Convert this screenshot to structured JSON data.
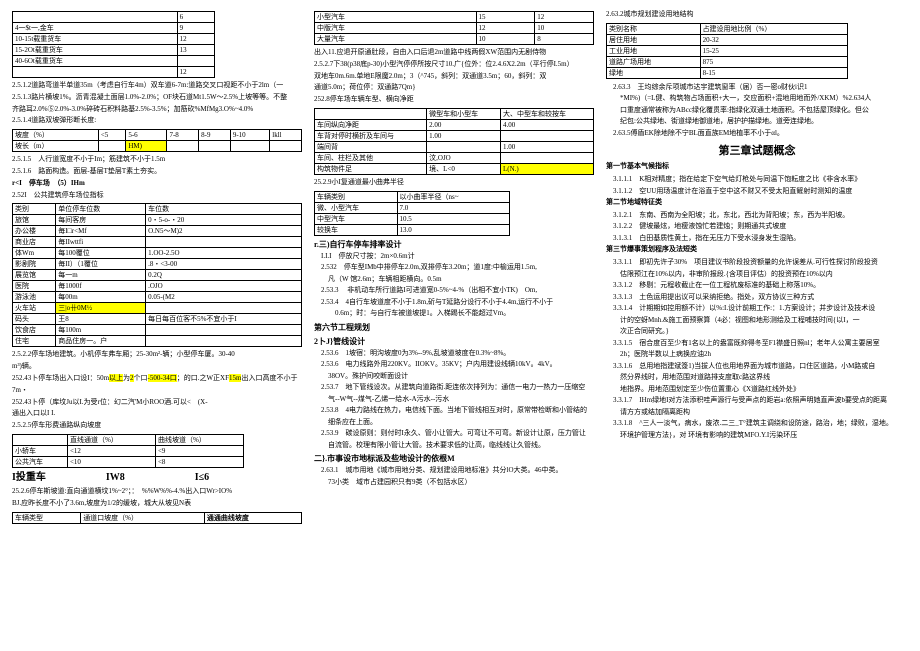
{
  "col1": {
    "t1": {
      "rows": [
        [
          "",
          "6"
        ],
        [
          "4一$t一,金车",
          "9"
        ],
        [
          "10-15t载重货车",
          "12"
        ],
        [
          "15-2Ot载重货车",
          "13"
        ],
        [
          "40-6Ot载重货车",
          ""
        ],
        [
          "",
          "12"
        ]
      ]
    },
    "p1": "2.5.1.2道路弯道半单道35m（考虑自行车4m）双车道6-7m:道路交叉口视距不小于2lm（一",
    "p2": "2.5.1.3路片横坡1%。沥青混凝土面层1.0%-2.0%；OF块石道Mt1.5W～2.5%上坡等等。不整",
    "p2b": "齐路耳2.0%⑤2.0%-3.0%碎砖石积料路基2.5%-3.5%；加筋砍%MfMg3.O%~4.0%",
    "p3": "2.5.1.4道路双坡弹形断长度:",
    "t2": {
      "head": [
        "坡度（%）",
        "<5",
        "5-6",
        "7-8",
        "8-9",
        "9-10",
        "lkll"
      ],
      "row": [
        "坡长（m）",
        "",
        "HM)",
        "",
        "",
        "",
        ""
      ]
    },
    "p4a": "2.5.1.5　人行道宽度不小于Im；筋建筑不小于1.5m",
    "p4_hl": "1.5m",
    "p5": "2.5.1.6　路面构造。面层-基层T垫层T素土夯实。",
    "p6": "r<I　停车场　（5）IHm",
    "p7": "2.52I　公共建筑停车场位指标",
    "t3": {
      "head": [
        "类别",
        "单位停车位数",
        "车位数"
      ],
      "rows": [
        [
          "旅馆",
          "每间客房",
          "0・5-o-・20"
        ],
        [
          "办公楼",
          "毎I□r<Mf",
          "O.N5～M)2"
        ],
        [
          "商业店",
          "毎IIwttfi",
          ""
        ],
        [
          "体Wm",
          "每100覆位",
          "1.OO-2.5O"
        ],
        [
          "影剧院",
          "毎II）（1覆位",
          ".8・<3-00"
        ],
        [
          "展览馆",
          "每一m",
          "0.2Q"
        ],
        [
          "医院",
          "毎1000f",
          ".OJO"
        ],
        [
          "游泳池",
          "每00m",
          "0.05-(M2"
        ],
        [
          "火车站",
          "三|o卄0M½",
          ""
        ],
        [
          "码头",
          "王8",
          "每日每百位客不5%不宜小于I"
        ],
        [
          "饮食店",
          "每100m",
          ""
        ],
        [
          "住宅",
          "商品住房一。户",
          ""
        ]
      ]
    },
    "p8": "2.5.2.2停车场地建筑。小机停车弗车厢；25-30m²-辆；小型停车厦。30-40",
    "p8b": "m³)辆。",
    "p9": "252.43卜停（库坟Ju以I.为受r位：幻二汽'M小ROO酒.可以<　(X-",
    "p9b": "通出入口以I I.",
    "p10": "2.5.2.5停车形费通路纵向坡度",
    "t4": {
      "head": [
        "",
        "直线通道（%）",
        "曲线坡道（%）"
      ],
      "rows": [
        [
          "小轿车",
          "<12",
          "<9"
        ],
        [
          "公共汽车",
          "<10",
          "<8"
        ]
      ]
    },
    "p11": "I投重车　　　　　　IW8　　　　　　　I≤6",
    "p12": "25.2.6停车斯坡道:直向通道横坟1%~2°；：　%%W%%-4.%出入口Wr>IO%",
    "p12b": "BJ.应昨长度不小了3.6m,坡度为1/2的缓坡，城大从坡见N表",
    "t5": {
      "head": [
        "车辆类型",
        "通道口坡度（%）",
        "通通曲线坡度"
      ]
    }
  },
  "col2": {
    "t1": {
      "rows": [
        [
          "小型汽车",
          "15",
          "12"
        ],
        [
          "中版汽车",
          "12",
          "10"
        ],
        [
          "大量汽车",
          "10",
          "8"
        ]
      ]
    },
    "p1": "出入11.应退开原通肚段，自由入口后退2m道路中线两假XW范围内无剧侍物",
    "p2": "2.5.2.7下38(p38底p-30)小型汽停停所按尺寸10.广{位外：位2.4.6X2.2m（平行停I.5m）",
    "p2b": "双地车0m.6m.单地E限魔2.0m；3（^745，斜列：双通道3.5m；60，斜列：双",
    "p2c": "通道5.0m；荷位停：双通路7Qm}",
    "p3": "252.8停车场车辆车型、横向净距",
    "t2": {
      "head": [
        "",
        "微型车和小型车",
        "大、中型车和较按车"
      ],
      "rows": [
        [
          "车间纵向净距",
          "2.00",
          "4.00"
        ],
        [
          "车背对停时横折及车间与",
          "1.00",
          ""
        ],
        [
          "端间背",
          "",
          "1.00"
        ],
        [
          "车间、柱栏及其他",
          "汶,OJO",
          ""
        ],
        [
          "构筑物件足",
          "境、L<0",
          "L(N.)"
        ]
      ]
    },
    "p4": "25.2.9小I复通道最小曲弗半径",
    "t3": {
      "head": [
        "车辆类别",
        "以小曲率半径（ns~"
      ],
      "rows": [
        [
          "微、小型汽车",
          "7.0"
        ],
        [
          "中型汽车",
          "10.5"
        ],
        [
          "较换车",
          "13.0"
        ]
      ]
    },
    "sec1": "r.三)自行车停车排率设计",
    "i1": "I.I.I　停放尺寸按：2m×0.6m计",
    "i2": "2.532　停车型IMb中排停车2.0m,双排停车3.20m；道1度:中榆运用1.5m,",
    "i2b": "凡（W 馆2.6m；车辆相距横向。0.5m",
    "i3": "2.53.3　 非机动车所行道路I可进道宽0-5%~4-%（出相不宜小TK)　Om,",
    "i4": "2.53.4　4自行车坡道度不小于1.8m,斫与T延路分设行不小于4.4m,运行不小于",
    "i4b": "　0.6m；时：与自行车被道坡提1。入梯踢长不能超过Vm。",
    "sec2": "第六节工程规划",
    "sec3": "2卜J}管线设计",
    "i5": "2.53.6　1坡宿：明沟坡度0为3%--9%,乱坡道坡度在0.3%~8%。",
    "i6": "2.53.6　电力线路外用220KV。IIOKV。35KV；户内用建设线辆10kV。4kV。",
    "i6b": "38OV。殊护间咬断面设计",
    "i7": "2.53.7　地下管线设次。从建筑向道路街.距连依次排列为：通信一电力一热力一压缩空",
    "i7b": "气--W气--煤气-乙烯一给水-A污水--污水",
    "i8": "2.53.8　4电力路线在热力，电信线下面。当地下管线相互对时，原常带检断和小管结的",
    "i8b": "细条应在上面。",
    "i9": "2.53.9　碳设原则：则付时I永久、管小让管大。可弯让不可弯。新设计让原，压力管让",
    "i9b": "自流管。校理有限小管让大管。技术要求低的让高，临线线让久管线。",
    "sec4": "二}.市事设市地标派及些地设计的依根M",
    "i10": "2.63.1　城市用地《城市用地分类、规划建设用地标准》共分lO大类。46中类。",
    "i10b": "73小类　域市占建园积只有9类（不包括水区）"
  },
  "col3": {
    "sec0": "2.63.2城市规划建设用地结构",
    "t1": {
      "head": [
        "类别名称",
        "占建设用地比例（%）"
      ],
      "rows": [
        [
          "居住用地",
          "20-32"
        ],
        [
          "工业用地",
          "15-25"
        ],
        [
          "道路广场用地",
          "875"
        ],
        [
          "绿地",
          "8-15"
        ]
      ]
    },
    "i1": "2.63.3　王均综余斥项城市达宇建筑窗率（届）否一密o财伙i识1",
    "i1b": "*MI%)（=L健、构筑物占场面积+大一，交应面积+混地用地而外/XKM）%2.634人",
    "i1c": "口重度通常被称为ABcc绿化覆贯率:指绿化双通土地面积。不包括屋顶绿化。但公",
    "i1d": "纪包:公共绿地、街道绿地御道地，居护护描绿地。道旁连绿地。",
    "i2": "2.63.5傅盾EK除地除不宁BL面直族EM地植率不小于αl。",
    "title": "第三章试题概念",
    "sec1": "第一节基本气候指标",
    "i3": "3.1.1.1　K相对精度；指在给定下空气给灯枪处与同温下饱耘度之比《非含水率》",
    "i4": "3.1.1.2　空UU用玚温度计在浴直于空中这不财又不受太阳直鏟射时测知的温度",
    "sec2": "第二节地域特征类",
    "i5": "3.1.2.1　东南、西南为全阳坡；北，东北，西北为背阳坡；东，西为半阳坡。",
    "i6": "3.1.2.2　健坡最炫，地瘦液蚀忙若建烛；则期通共式坡度",
    "i7": "3.1.3.1　白田基质性黄土，指在无压力下受水浸身发生湿陷。",
    "sec3": "第三节爆事策划程序及法短类",
    "i8": "3.3.1.1　即初先许子30%　项目建议书阶段投资额量的允许误差从.可行性探讨阶段投资",
    "i8b": "估限预江在10%以内，非审阶报段.{含项目评估）的投资预在10%以内",
    "i9": "3.3.1.2　移剔：元程收截止在一位工程杭废标准的基础上称落10%。",
    "i10": "3.3.1.3　土色运用提出议可以采纳拒绝。指处，双方协议三种方式",
    "i11": "3.3.1.4　计期期如控用额不计）以%:I.设计前期工作:：1.方案设计；并步设计及技术设",
    "i11b": "计的空蚜Mnh.&施工面预察算（4必：视图和地形测绘及工程哺技时间{以I，一",
    "i11c": "次正合同研究。}",
    "i12": "3.3.1.5　宿合度百至少有1名以上的盎富既抑得冬至F1襟盛日照nl；老年人公寓主要居室",
    "i12b": "2h；医院半数以上病换应油2h",
    "i13": "3.3.1.6　总用地指建斌簽1)当拔人位也用地界面为城市道路，口住区道路，小M路或自",
    "i13b": "然分界线时，用地范围对道路排支度取c路这界线",
    "i13c": "地指界。用地范围划定至少伤位置重心《X道路红线外处》",
    "i14": "3.3.1.7　IHm绿地I对方法添积哇声源行与受声点的距岩a:依照声明她直声波b要受点的距离",
    "i14b": "请方方或结加隔离距构",
    "i15": "3.3.1.8　^三人一淡气，病水，废浓.二三_T°建筑主调绕和设防途，路治，地；绿败，湿地。",
    "i15b": "环境护管理方法}，对 环境有影响的建筑MFO.Y.I污染环压"
  }
}
